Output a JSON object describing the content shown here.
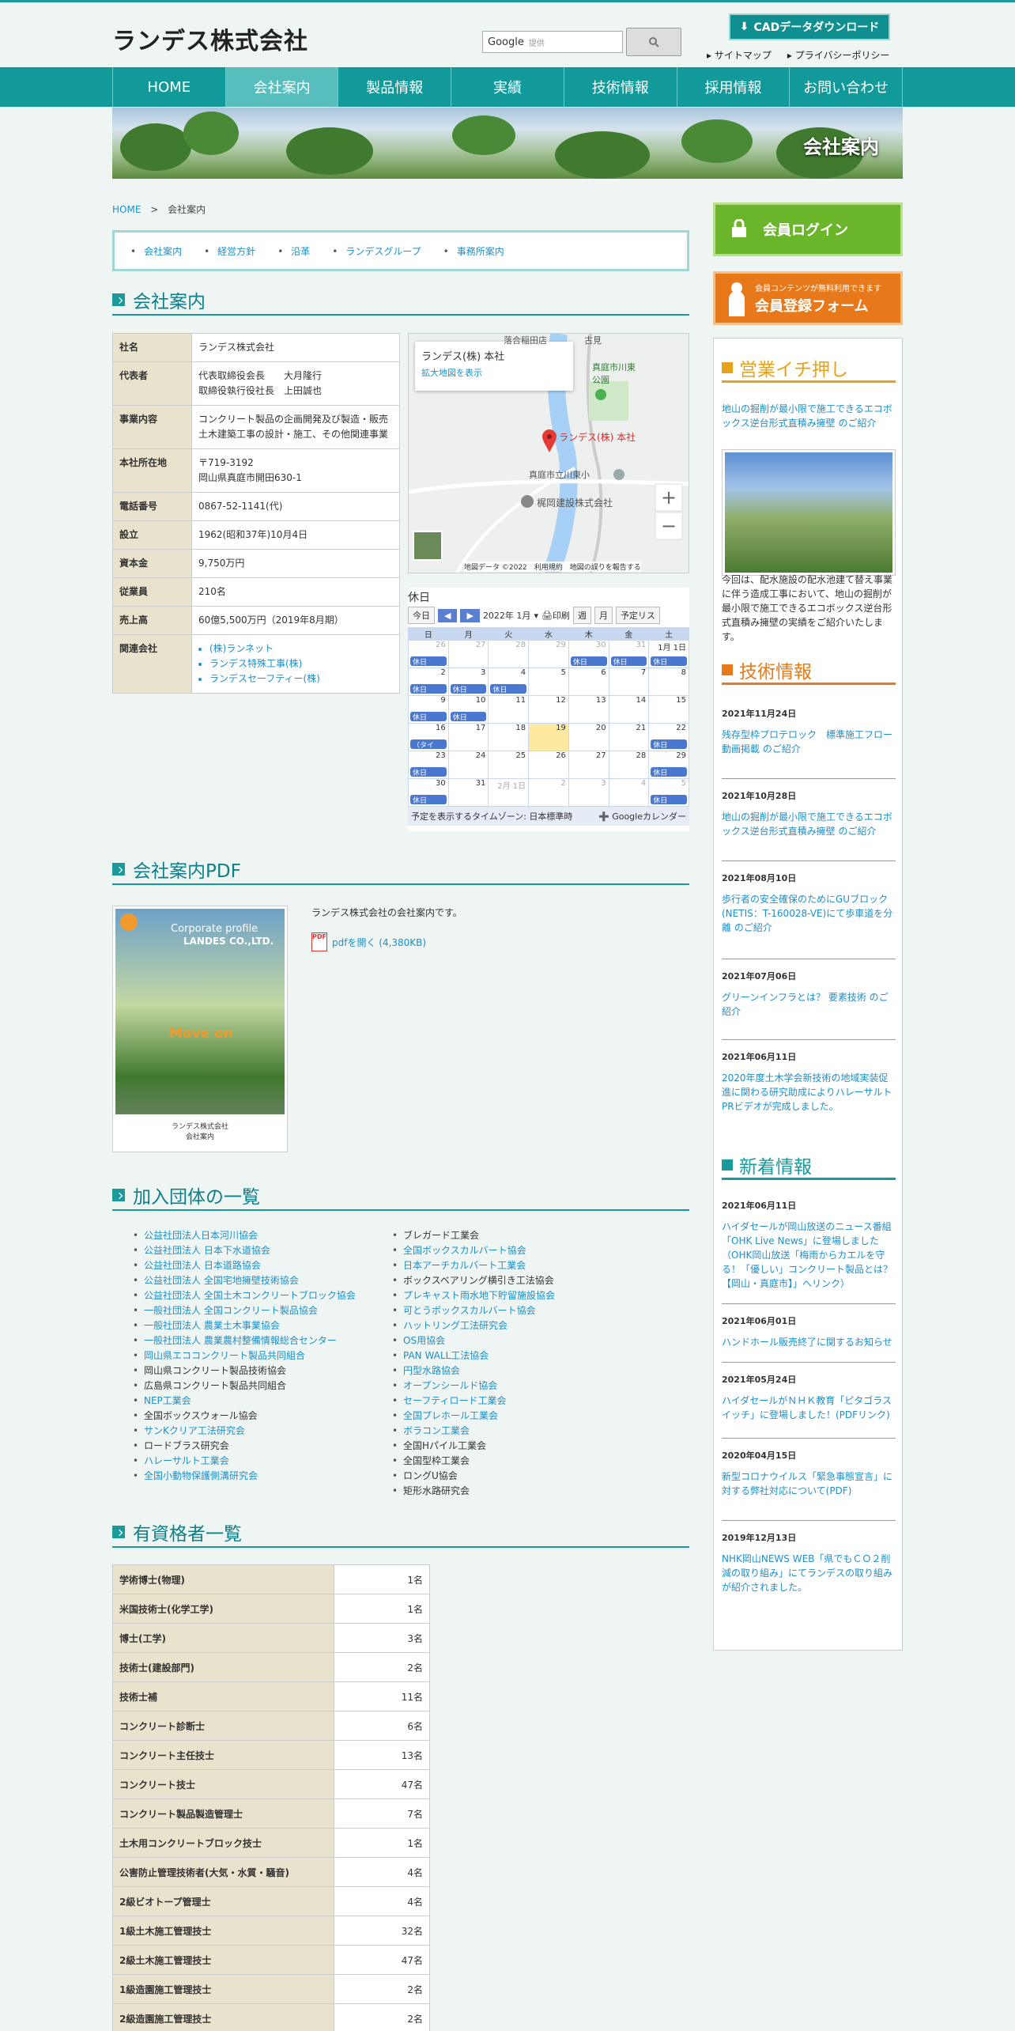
{
  "header": {
    "logo": "ランデス株式会社",
    "search_brand": "Google",
    "search_placeholder": "提供",
    "search_button_icon": "search-icon",
    "cad_button": "CADデータダウンロード",
    "links": [
      "サイトマップ",
      "プライバシーポリシー"
    ]
  },
  "nav": [
    "HOME",
    "会社案内",
    "製品情報",
    "実績",
    "技術情報",
    "採用情報",
    "お問い合わせ"
  ],
  "nav_active": "会社案内",
  "hero_title": "会社案内",
  "breadcrumb": {
    "home": "HOME",
    "sep": ">",
    "current": "会社案内"
  },
  "subnav": [
    "会社案内",
    "経営方針",
    "沿革",
    "ランデスグループ",
    "事務所案内"
  ],
  "company": {
    "heading": "会社案内",
    "rows": [
      {
        "k": "社名",
        "v": "ランデス株式会社"
      },
      {
        "k": "代表者",
        "v": "代表取締役会長　　大月隆行\n取締役執行役社長　上田誠也"
      },
      {
        "k": "事業内容",
        "v": "コンクリート製品の企画開発及び製造・販売 土木建築工事の設計・施工、その他関連事業"
      },
      {
        "k": "本社所在地",
        "v": "〒719-3192\n岡山県真庭市開田630-1"
      },
      {
        "k": "電話番号",
        "v": "0867-52-1141(代)"
      },
      {
        "k": "設立",
        "v": "1962(昭和37年)10月4日"
      },
      {
        "k": "資本金",
        "v": "9,750万円"
      },
      {
        "k": "従業員",
        "v": "210名"
      },
      {
        "k": "売上高",
        "v": "60億5,500万円（2019年8月期）"
      },
      {
        "k": "関連会社",
        "v": ""
      }
    ],
    "related": [
      "(株)ランネット",
      "ランデス特殊工事(株)",
      "ランデスセーフティー(株)"
    ]
  },
  "map": {
    "card_title": "ランデス(株) 本社",
    "card_link": "拡大地図を表示",
    "pin_label": "ランデス(株) 本社",
    "labels": [
      "真庭市川東公園",
      "真庭市立川東小",
      "梶岡建設株式会社",
      "落合稲田店",
      "古見"
    ],
    "footer": "地図データ ©2022　利用規約　地図の誤りを報告する",
    "zoom_in": "+",
    "zoom_out": "−"
  },
  "calendar": {
    "title": "休日",
    "today": "今日",
    "month": "2022年 1月",
    "print": "印刷",
    "views": [
      "週",
      "月",
      "予定リス"
    ],
    "weekdays": [
      "日",
      "月",
      "火",
      "水",
      "木",
      "金",
      "土"
    ],
    "event": "休日",
    "event_alt": "（タイ",
    "days": [
      {
        "d": "26",
        "g": true,
        "e": "休日"
      },
      {
        "d": "27",
        "g": true
      },
      {
        "d": "28",
        "g": true
      },
      {
        "d": "29",
        "g": true
      },
      {
        "d": "30",
        "g": true,
        "e": "休日"
      },
      {
        "d": "31",
        "g": true,
        "e": "休日"
      },
      {
        "d": "1月 1日",
        "e": "休日"
      },
      {
        "d": "2",
        "e": "休日"
      },
      {
        "d": "3",
        "e": "休日"
      },
      {
        "d": "4",
        "e": "休日"
      },
      {
        "d": "5"
      },
      {
        "d": "6"
      },
      {
        "d": "7"
      },
      {
        "d": "8"
      },
      {
        "d": "9",
        "e": "休日"
      },
      {
        "d": "10",
        "e": "休日"
      },
      {
        "d": "11"
      },
      {
        "d": "12"
      },
      {
        "d": "13"
      },
      {
        "d": "14"
      },
      {
        "d": "15"
      },
      {
        "d": "16",
        "e": "（タイ"
      },
      {
        "d": "17"
      },
      {
        "d": "18"
      },
      {
        "d": "19",
        "t": true
      },
      {
        "d": "20"
      },
      {
        "d": "21"
      },
      {
        "d": "22",
        "e": "休日"
      },
      {
        "d": "23",
        "e": "休日"
      },
      {
        "d": "24"
      },
      {
        "d": "25"
      },
      {
        "d": "26"
      },
      {
        "d": "27"
      },
      {
        "d": "28"
      },
      {
        "d": "29",
        "e": "休日"
      },
      {
        "d": "30",
        "e": "休日"
      },
      {
        "d": "31"
      },
      {
        "d": "2月 1日",
        "g": true
      },
      {
        "d": "2",
        "g": true
      },
      {
        "d": "3",
        "g": true
      },
      {
        "d": "4",
        "g": true
      },
      {
        "d": "5",
        "g": true,
        "e": "休日"
      }
    ],
    "footer_tz": "予定を表示するタイムゾーン: 日本標準時",
    "footer_brand": "Googleカレンダー"
  },
  "pdf": {
    "heading": "会社案内PDF",
    "desc": "ランデス株式会社の会社案内です。",
    "link": "pdfを開く (4,380KB)",
    "cover_en": "Corporate profile",
    "cover_co": "LANDES CO.,LTD.",
    "cover_move": "Move on",
    "cover_footer": "ランデス株式会社\n会社案内",
    "pdf_badge": "PDF"
  },
  "orgs": {
    "heading": "加入団体の一覧",
    "left": [
      {
        "t": "公益社団法人日本河川協会",
        "l": true
      },
      {
        "t": "公益社団法人 日本下水道協会",
        "l": true
      },
      {
        "t": "公益社団法人 日本道路協会",
        "l": true
      },
      {
        "t": "公益社団法人 全国宅地擁壁技術協会",
        "l": true
      },
      {
        "t": "公益社団法人 全国土木コンクリートブロック協会",
        "l": true
      },
      {
        "t": "一般社団法人 全国コンクリート製品協会",
        "l": true
      },
      {
        "t": "一般社団法人 農業土木事業協会",
        "l": true
      },
      {
        "t": "一般社団法人 農業農村整備情報総合センター",
        "l": true
      },
      {
        "t": "岡山県エココンクリート製品共同組合",
        "l": true
      },
      {
        "t": "岡山県コンクリート製品技術協会",
        "l": false
      },
      {
        "t": "広島県コンクリート製品共同組合",
        "l": false
      },
      {
        "t": "NEP工業会",
        "l": true
      },
      {
        "t": "全国ボックスウォール協会",
        "l": false
      },
      {
        "t": "サンKクリア工法研究会",
        "l": true
      },
      {
        "t": "ロードブラス研究会",
        "l": false
      },
      {
        "t": "ハレーサルト工業会",
        "l": true
      },
      {
        "t": "全国小動物保護側溝研究会",
        "l": true
      }
    ],
    "right": [
      {
        "t": "ブレガード工業会",
        "l": false
      },
      {
        "t": "全国ボックスカルバート協会",
        "l": true
      },
      {
        "t": "日本アーチカルバート工業会",
        "l": true
      },
      {
        "t": "ボックスベアリング横引き工法協会",
        "l": false
      },
      {
        "t": "プレキャスト雨水地下貯留施設協会",
        "l": true
      },
      {
        "t": "可とうボックスカルバート協会",
        "l": true
      },
      {
        "t": "ハットリング工法研究会",
        "l": true
      },
      {
        "t": "OS用協会",
        "l": true
      },
      {
        "t": "PAN WALL工法協会",
        "l": true
      },
      {
        "t": "円型水路協会",
        "l": true
      },
      {
        "t": "オープンシールド協会",
        "l": true
      },
      {
        "t": "セーフティロード工業会",
        "l": true
      },
      {
        "t": "全国プレホール工業会",
        "l": true
      },
      {
        "t": "ボラコン工業会",
        "l": true
      },
      {
        "t": "全国Hパイル工業会",
        "l": false
      },
      {
        "t": "全国型枠工業会",
        "l": false
      },
      {
        "t": "ロングU協会",
        "l": false
      },
      {
        "t": "矩形水路研究会",
        "l": false
      }
    ]
  },
  "quals": {
    "heading": "有資格者一覧",
    "rows": [
      {
        "k": "学術博士(物理)",
        "v": "1名"
      },
      {
        "k": "米国技術士(化学工学)",
        "v": "1名"
      },
      {
        "k": "博士(工学)",
        "v": "3名"
      },
      {
        "k": "技術士(建設部門)",
        "v": "2名"
      },
      {
        "k": "技術士補",
        "v": "11名"
      },
      {
        "k": "コンクリート診断士",
        "v": "6名"
      },
      {
        "k": "コンクリート主任技士",
        "v": "13名"
      },
      {
        "k": "コンクリート技士",
        "v": "47名"
      },
      {
        "k": "コンクリート製品製造管理士",
        "v": "7名"
      },
      {
        "k": "土木用コンクリートブロック技士",
        "v": "1名"
      },
      {
        "k": "公害防止管理技術者(大気・水質・騒音)",
        "v": "4名"
      },
      {
        "k": "2級ビオトープ管理士",
        "v": "4名"
      },
      {
        "k": "1級土木施工管理技士",
        "v": "32名"
      },
      {
        "k": "2級土木施工管理技士",
        "v": "47名"
      },
      {
        "k": "1級造園施工管理技士",
        "v": "2名"
      },
      {
        "k": "2級造園施工管理技士",
        "v": "2名"
      }
    ]
  },
  "sidebar": {
    "login": "会員ログイン",
    "register_small": "会員コンテンツが無料利用できます",
    "register_big": "会員登録フォーム",
    "featured_heading": "営業イチ押し",
    "featured_link": "地山の掘削が最小限で施工できるエコボックス逆台形式直積み擁壁 のご紹介",
    "featured_text": "今回は、配水施設の配水池建て替え事業に伴う造成工事において、地山の掘削が最小限で施工できるエコボックス逆台形式直積み擁壁の実績をご紹介いたします。",
    "tech_heading": "技術情報",
    "tech": [
      {
        "d": "2021年11月24日",
        "t": "残存型枠プロテロック　標準施工フロー動画掲載 のご紹介"
      },
      {
        "d": "2021年10月28日",
        "t": "地山の掘削が最小限で施工できるエコボックス逆台形式直積み擁壁 のご紹介"
      },
      {
        "d": "2021年08月10日",
        "t": "歩行者の安全確保のためにGUブロック(NETIS：T-160028-VE)にて歩車道を分離 のご紹介"
      },
      {
        "d": "2021年07月06日",
        "t": "グリーンインフラとは？ 要素技術 のご紹介"
      },
      {
        "d": "2021年06月11日",
        "t": "2020年度土木学会新技術の地域実装促進に関わる研究助成によりハレーサルトPRビデオが完成しました。"
      }
    ],
    "news_heading": "新着情報",
    "news": [
      {
        "d": "2021年06月11日",
        "t": "ハイダセールが岡山放送のニュース番組「OHK Live News」に登場しました（OHK岡山放送「梅雨からカエルを守る！「優しい」コンクリート製品とは？【岡山・真庭市】」へリンク）"
      },
      {
        "d": "2021年06月01日",
        "t": "ハンドホール販売終了に関するお知らせ"
      },
      {
        "d": "2021年05月24日",
        "t": "ハイダセールがＮＨＫ教育「ピタゴラスイッチ」に登場しました！(PDFリンク)"
      },
      {
        "d": "2020年04月15日",
        "t": "新型コロナウイルス「緊急事態宣言」に対する弊社対応について(PDF)"
      },
      {
        "d": "2019年12月13日",
        "t": "NHK岡山NEWS WEB「県でもＣＯ２削減の取り組み」にてランデスの取り組みが紹介されました。"
      }
    ],
    "colors": {
      "featured": "#e8a21a",
      "tech": "#e87a1a",
      "news": "#1a9a9a"
    }
  }
}
